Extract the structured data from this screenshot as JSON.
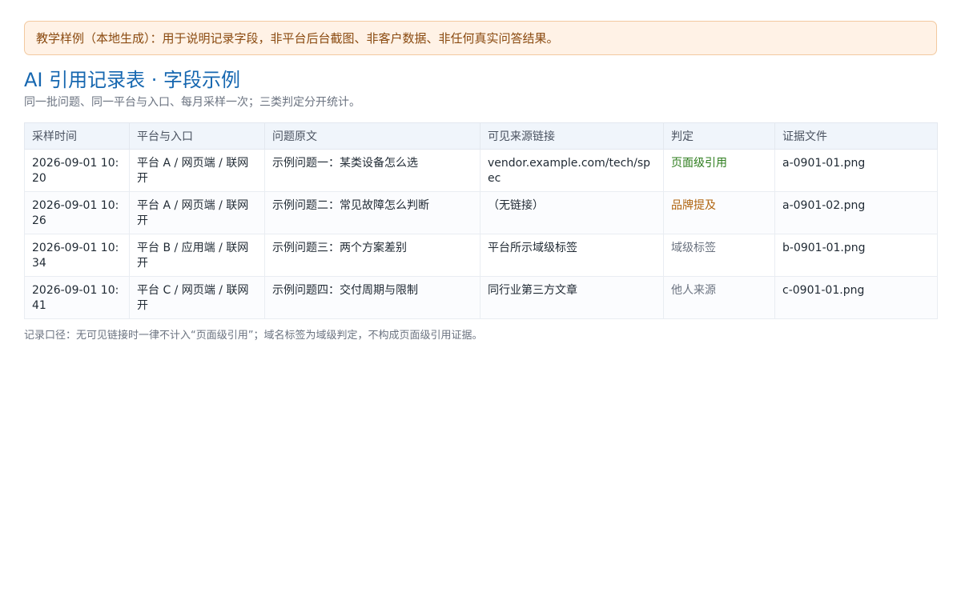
{
  "notice": "教学样例（本地生成）：用于说明记录字段，非平台后台截图、非客户数据、非任何真实问答结果。",
  "title": "AI 引用记录表 · 字段示例",
  "subtitle": "同一批问题、同一平台与入口、每月采样一次；三类判定分开统计。",
  "table": {
    "headers": [
      "采样时间",
      "平台与入口",
      "问题原文",
      "可见来源链接",
      "判定",
      "证据文件"
    ],
    "rows": [
      {
        "time": "2026-09-01 10:20",
        "platform": "平台 A / 网页端 / 联网开",
        "question": "示例问题一：某类设备怎么选",
        "source": "vendor.example.com/tech/spec",
        "verdict": "页面级引用",
        "verdict_color": "#2e7d1e",
        "evidence": "a-0901-01.png"
      },
      {
        "time": "2026-09-01 10:26",
        "platform": "平台 A / 网页端 / 联网开",
        "question": "示例问题二：常见故障怎么判断",
        "source": "（无链接）",
        "verdict": "品牌提及",
        "verdict_color": "#b0640f",
        "evidence": "a-0901-02.png"
      },
      {
        "time": "2026-09-01 10:34",
        "platform": "平台 B / 应用端 / 联网开",
        "question": "示例问题三：两个方案差别",
        "source": "平台所示域级标签",
        "verdict": "域级标签",
        "verdict_color": "#6b7380",
        "evidence": "b-0901-01.png"
      },
      {
        "time": "2026-09-01 10:41",
        "platform": "平台 C / 网页端 / 联网开",
        "question": "示例问题四：交付周期与限制",
        "source": "同行业第三方文章",
        "verdict": "他人来源",
        "verdict_color": "#6b7380",
        "evidence": "c-0901-01.png"
      }
    ]
  },
  "footnote": "记录口径：无可见链接时一律不计入“页面级引用”；域名标签为域级判定，不构成页面级引用证据。"
}
